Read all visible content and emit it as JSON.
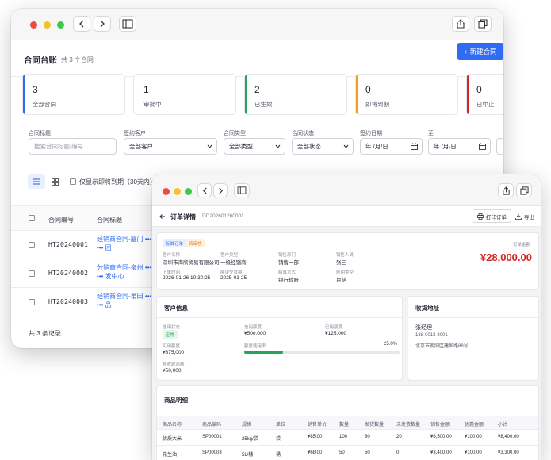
{
  "contracts_window": {
    "title": "合同台账",
    "count_text": "共 3 个合同",
    "new_button": "+ 新建合同",
    "stats": [
      {
        "value": "3",
        "label": "全部合同",
        "color": "#2f6cf2"
      },
      {
        "value": "1",
        "label": "审批中",
        "color": "#2f6cf2"
      },
      {
        "value": "2",
        "label": "已生效",
        "color": "#22a559"
      },
      {
        "value": "0",
        "label": "即将到期",
        "color": "#f0a020"
      },
      {
        "value": "0",
        "label": "已中止",
        "color": "#d6231d"
      }
    ],
    "filters": {
      "title_label": "合同标题",
      "title_placeholder": "搜索合同标题/编号",
      "customer_label": "签约客户",
      "customer_value": "全部客户",
      "type_label": "合同类型",
      "type_value": "全部类型",
      "status_label": "合同状态",
      "status_value": "全部状态",
      "date_label": "签约日期",
      "date_from": "年 /月/日",
      "to_label": "至",
      "date_to": "年 /月/日"
    },
    "expiring_toggle": "仅显示即将到期（30天内）",
    "table": {
      "headers": [
        "合同编号",
        "合同标题"
      ],
      "rows": [
        {
          "code": "HT20240001",
          "title_line1": "经销商合同-厦门",
          "title_line2": "团"
        },
        {
          "code": "HT20240002",
          "title_line1": "分销商合同-泉州",
          "title_line2": "发中心"
        },
        {
          "code": "HT20240003",
          "title_line1": "经销商合同-莆田",
          "title_line2": "品"
        }
      ]
    },
    "footer": "共 3 条记录"
  },
  "order_window": {
    "title": "订单详情",
    "order_no": "DD202601260001",
    "print_button": "打印订单",
    "export_button": "导出",
    "tags": [
      {
        "text": "标准订单",
        "color": "#2f6cf2",
        "bg": "#e8efff"
      },
      {
        "text": "待审核",
        "color": "#e07d10",
        "bg": "#fff1e0"
      }
    ],
    "amount_label": "订单金额",
    "amount": "¥28,000.00",
    "fields": [
      {
        "key": "客户名称",
        "value": "深圳市海欣贸易有限公司"
      },
      {
        "key": "客户类型",
        "value": "一级经销商"
      },
      {
        "key": "销售部门",
        "value": "销售一部"
      },
      {
        "key": "销售人员",
        "value": "张三"
      },
      {
        "key": "下单时间",
        "value": "2026-01-26 10:30:25"
      },
      {
        "key": "期望交货期",
        "value": "2025-01-25"
      },
      {
        "key": "结算方式",
        "value": "银行转账"
      },
      {
        "key": "账期类型",
        "value": "月结"
      }
    ],
    "customer_info": {
      "title": "客户信息",
      "credit_status_label": "信用状态",
      "credit_status": "正常",
      "credit_limit_label": "信用额度",
      "credit_limit": "¥500,000",
      "used_limit_label": "已用额度",
      "used_limit": "¥125,000",
      "available_label": "可用额度",
      "available": "¥375,000",
      "usage_label": "额度使用率",
      "usage_text": "25.0%",
      "usage_fraction": 0.25,
      "prepaid_label": "预收款余额",
      "prepaid": "¥50,000"
    },
    "shipping": {
      "title": "收货地址",
      "name": "张经理",
      "phone": "138-0013-8001",
      "address": "北京市朝阳区建国路88号"
    },
    "products": {
      "title": "商品明细",
      "headers": [
        "商品名称",
        "商品编码",
        "规格",
        "单位",
        "销售单价",
        "数量",
        "发货数量",
        "未发货数量",
        "销售金额",
        "优惠金额",
        "小计"
      ],
      "rows": [
        [
          "优质大米",
          "SP00001",
          "25kg/袋",
          "袋",
          "¥85.00",
          "100",
          "80",
          "20",
          "¥8,500.00",
          "¥100.00",
          "¥8,400.00"
        ],
        [
          "花生油",
          "SP00003",
          "5L/桶",
          "桶",
          "¥68.00",
          "50",
          "50",
          "0",
          "¥3,400.00",
          "¥100.00",
          "¥3,300.00"
        ]
      ]
    }
  }
}
